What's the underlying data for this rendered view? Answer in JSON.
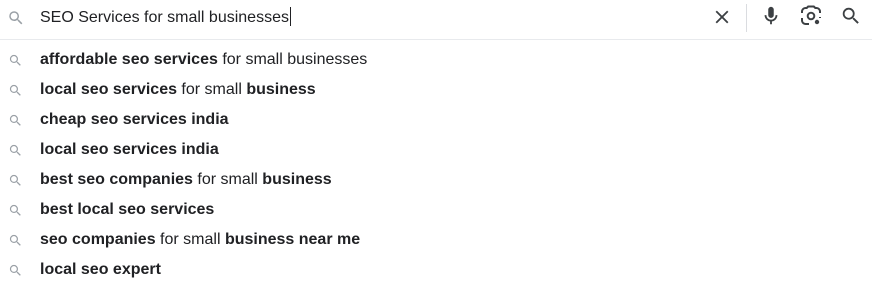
{
  "search": {
    "query": "SEO Services for small businesses"
  },
  "icons": {
    "lead": "search-icon",
    "clear": "close-icon",
    "mic": "microphone-icon",
    "lens": "google-lens-icon",
    "submit": "search-icon"
  },
  "colors": {
    "icon_dark": "#3c4043",
    "icon_gray": "#9aa0a6",
    "text": "#202124",
    "divider": "#dadce0"
  },
  "suggestions": [
    {
      "segments": [
        {
          "text": "affordable seo services",
          "bold": true
        },
        {
          "text": " for small businesses",
          "bold": false
        }
      ]
    },
    {
      "segments": [
        {
          "text": "local seo services",
          "bold": true
        },
        {
          "text": " for small ",
          "bold": false
        },
        {
          "text": "business",
          "bold": true
        }
      ]
    },
    {
      "segments": [
        {
          "text": "cheap seo services india",
          "bold": true
        }
      ]
    },
    {
      "segments": [
        {
          "text": "local seo services india",
          "bold": true
        }
      ]
    },
    {
      "segments": [
        {
          "text": "best seo companies",
          "bold": true
        },
        {
          "text": " for small ",
          "bold": false
        },
        {
          "text": "business",
          "bold": true
        }
      ]
    },
    {
      "segments": [
        {
          "text": "best local seo services",
          "bold": true
        }
      ]
    },
    {
      "segments": [
        {
          "text": "seo companies",
          "bold": true
        },
        {
          "text": " for small ",
          "bold": false
        },
        {
          "text": "business near me",
          "bold": true
        }
      ]
    },
    {
      "segments": [
        {
          "text": "local seo expert",
          "bold": true
        }
      ]
    }
  ]
}
